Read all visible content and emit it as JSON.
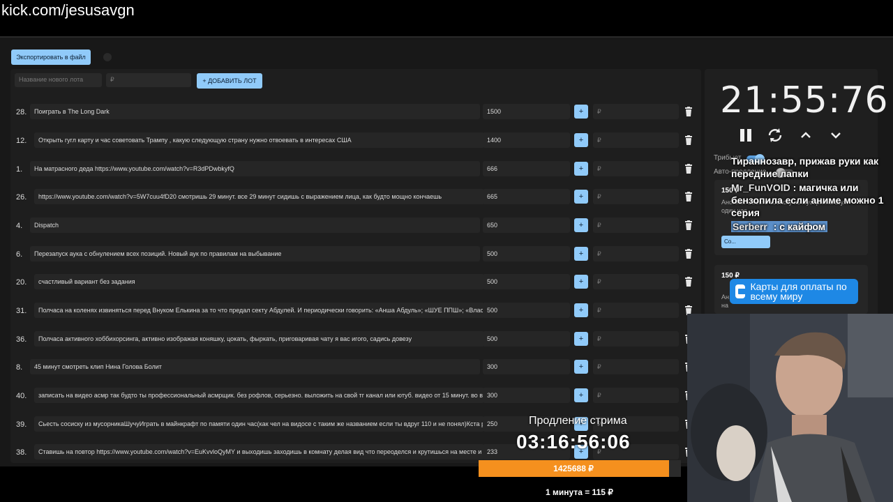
{
  "url": "kick.com/jesusavgn",
  "toolbar": {
    "export_label": "Экспортировать в файл",
    "new_lot_placeholder": "Название нового лота",
    "new_price_placeholder": "₽",
    "add_lot_label": "+ ДОБАВИТЬ ЛОТ"
  },
  "lots": [
    {
      "num": "28.",
      "name": "Поиграть в The Long Dark",
      "amount": "1500"
    },
    {
      "num": "12.",
      "name": "Открыть гугл карту и час советовать Трампу , какую следующую страну нужно отвоевать в интересах США",
      "amount": "1400"
    },
    {
      "num": "1.",
      "name": "На матрасного деда https://www.youtube.com/watch?v=R3dPDwbkyfQ",
      "amount": "666"
    },
    {
      "num": "26.",
      "name": "https://www.youtube.com/watch?v=5W7cuu4fD20 смотришь 29 минут. все 29 минут сидишь с выражением лица, как будто мощно кончаешь",
      "amount": "665"
    },
    {
      "num": "4.",
      "name": "Dispatch",
      "amount": "650"
    },
    {
      "num": "6.",
      "name": "Перезапуск аука с обнулением всех позиций. Новый аук по правилам на выбывание",
      "amount": "500"
    },
    {
      "num": "20.",
      "name": "счастливый вариант без задания",
      "amount": "500"
    },
    {
      "num": "31.",
      "name": "Полчаса на коленях извиняться перед Внуком Елькина за то что предал секту Абдулей. И периодически говорить: «Анша Абдуль»; «ШУЕ ППШ»; «Власт",
      "amount": "500"
    },
    {
      "num": "36.",
      "name": "Полчаса активного хоббихорсинга, активно изображая коняшку, цокать, фыркать, приговаривая чату я вас игого, садись довезу",
      "amount": "500"
    },
    {
      "num": "8.",
      "name": "45 минут смотреть клип Нина Голова Болит",
      "amount": "300"
    },
    {
      "num": "40.",
      "name": "записать на видео асмр так будто ты профессиональный асмрщик. без рофлов, серьезно. выложить на свой тг канал или ютуб. видео от 15 минут. во вр",
      "amount": "300"
    },
    {
      "num": "39.",
      "name": "Сьесть сосиску из мусорникаШучуИграть в майнкрафт по памяти один час(как чел на видосе с таким же названием если ты вдруг 110 и не понял)Кста р",
      "amount": "250"
    },
    {
      "num": "38.",
      "name": "Ставишь на повтор https://www.youtube.com/watch?v=EuKvvloQyMY и выходишь заходишь в комнату делая вид что переоделся и крутишься на месте и г",
      "amount": "233"
    }
  ],
  "price_placeholder": "₽",
  "timer": "21:55:76",
  "toggles": {
    "tribute_label": "Трибьют",
    "auto_label": "Авто-продление"
  },
  "donations": [
    {
      "amount": "150 ₽",
      "text": "Аноним: Сьесть сосиску из мусорника Шу... один час",
      "button": "Со..."
    },
    {
      "amount": "150 ₽",
      "text": "Ан... (л... «летаешь» вокруг камеры прыжками на"
    }
  ],
  "chat": [
    {
      "nick": "",
      "text": "Тираннозавр, прижав руки как передние лапки"
    },
    {
      "nick": "Mr_FunVOID",
      "text": " : магичка или бензопила если аниме можно 1 серия"
    },
    {
      "nick": "Serberr",
      "text": " : с кайфом"
    }
  ],
  "banner": "Карты для оплаты по всему миру",
  "extension": {
    "title": "Продление стрима",
    "timer": "03:16:56:06",
    "total": "1425688 ₽",
    "progress": 0.94,
    "rate": "1 минута = 115 ₽"
  },
  "colors": {
    "accent": "#90caf9",
    "progress": "#f5901e",
    "banner": "#1e88e5"
  }
}
